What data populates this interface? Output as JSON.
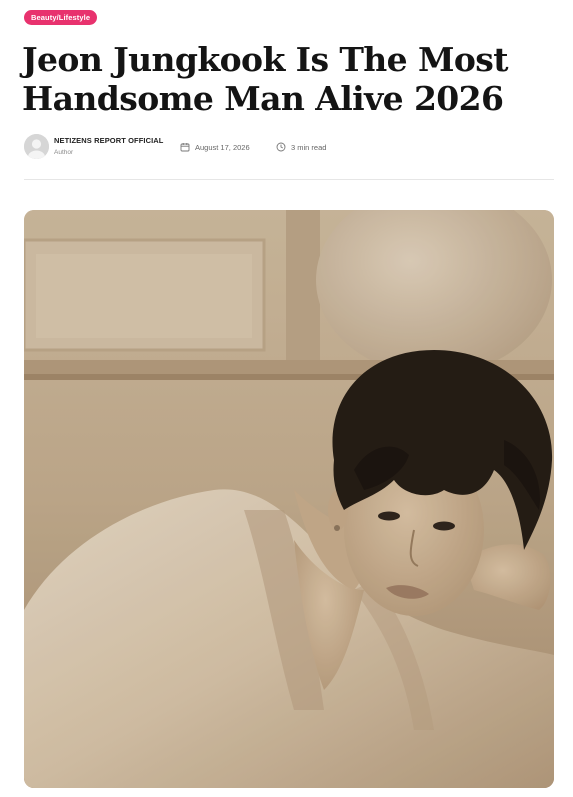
{
  "article": {
    "category": "Beauty/Lifestyle",
    "title_line1": "Jeon Jungkook Is The Most",
    "title_line2": "Handsome Man Alive 2026"
  },
  "meta": {
    "author_name": "NETIZENS REPORT OFFICIAL",
    "author_role": "Author",
    "date": "August 17, 2026",
    "read_time": "3 min read",
    "date_icon": "calendar-icon",
    "time_icon": "clock-icon"
  },
  "colors": {
    "badge": "#e8326e",
    "title": "#141414",
    "meta_text": "#666666",
    "image_tone": "#cdb89d"
  }
}
